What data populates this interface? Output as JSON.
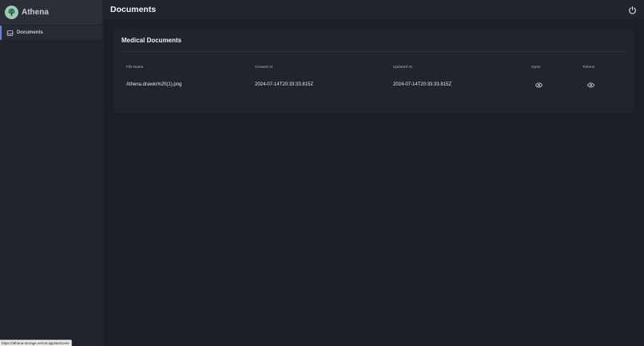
{
  "sidebar": {
    "brand_name": "Athena",
    "items": [
      {
        "label": "Documents",
        "icon": "inbox-icon",
        "active": true
      }
    ]
  },
  "header": {
    "title": "Documents",
    "power_icon": "power-icon"
  },
  "card": {
    "title": "Medical Documents",
    "table": {
      "columns": [
        "File Name",
        "Created At",
        "Updated At",
        "Open",
        "Tokens"
      ],
      "rows": [
        {
          "file_name": "Athena.drawio%20(1).png",
          "created_at": "2024-07-14T20:33:33.815Z",
          "updated_at": "2024-07-14T20:33:33.815Z",
          "open_icon": "eye-icon",
          "tokens_icon": "eye-icon"
        }
      ]
    }
  },
  "status_bar": {
    "url": "https://athena-storage.vercel.app/welcome"
  },
  "colors": {
    "background": "#1b1f27",
    "panel": "#20242c",
    "accent": "#6d7ce0",
    "logo": "#9fc9b3"
  }
}
